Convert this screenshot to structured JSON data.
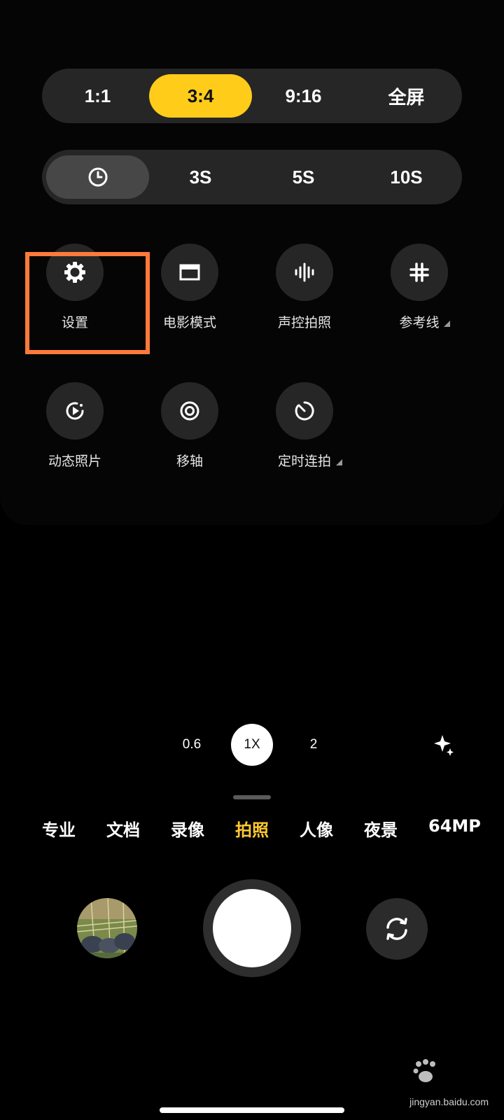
{
  "aspect_ratio": {
    "options": [
      "1:1",
      "3:4",
      "9:16",
      "全屏"
    ],
    "selected": "3:4",
    "accent": "#ffcc1a"
  },
  "timer": {
    "options": [
      "3S",
      "5S",
      "10S"
    ],
    "selected_icon": "clock-icon"
  },
  "tiles": {
    "settings": {
      "label": "设置",
      "icon": "gear-icon"
    },
    "movie": {
      "label": "电影模式",
      "icon": "widescreen-icon"
    },
    "voice": {
      "label": "声控拍照",
      "icon": "soundwave-icon"
    },
    "grid": {
      "label": "参考线",
      "icon": "grid-icon"
    },
    "live_photo": {
      "label": "动态照片",
      "icon": "live-photo-icon"
    },
    "tilt_shift": {
      "label": "移轴",
      "icon": "tilt-shift-icon"
    },
    "timed_burst": {
      "label": "定时连拍",
      "icon": "timed-burst-icon"
    }
  },
  "highlight_color": "#ff7a3a",
  "zoom": {
    "levels": [
      "0.6",
      "1X",
      "2"
    ],
    "selected": "1X"
  },
  "modes": {
    "items": [
      "专业",
      "文档",
      "录像",
      "拍照",
      "人像",
      "夜景",
      "64MP"
    ],
    "selected": "拍照",
    "active_color": "#ffc930"
  },
  "watermark": {
    "text": "jingyan.baidu.com"
  }
}
